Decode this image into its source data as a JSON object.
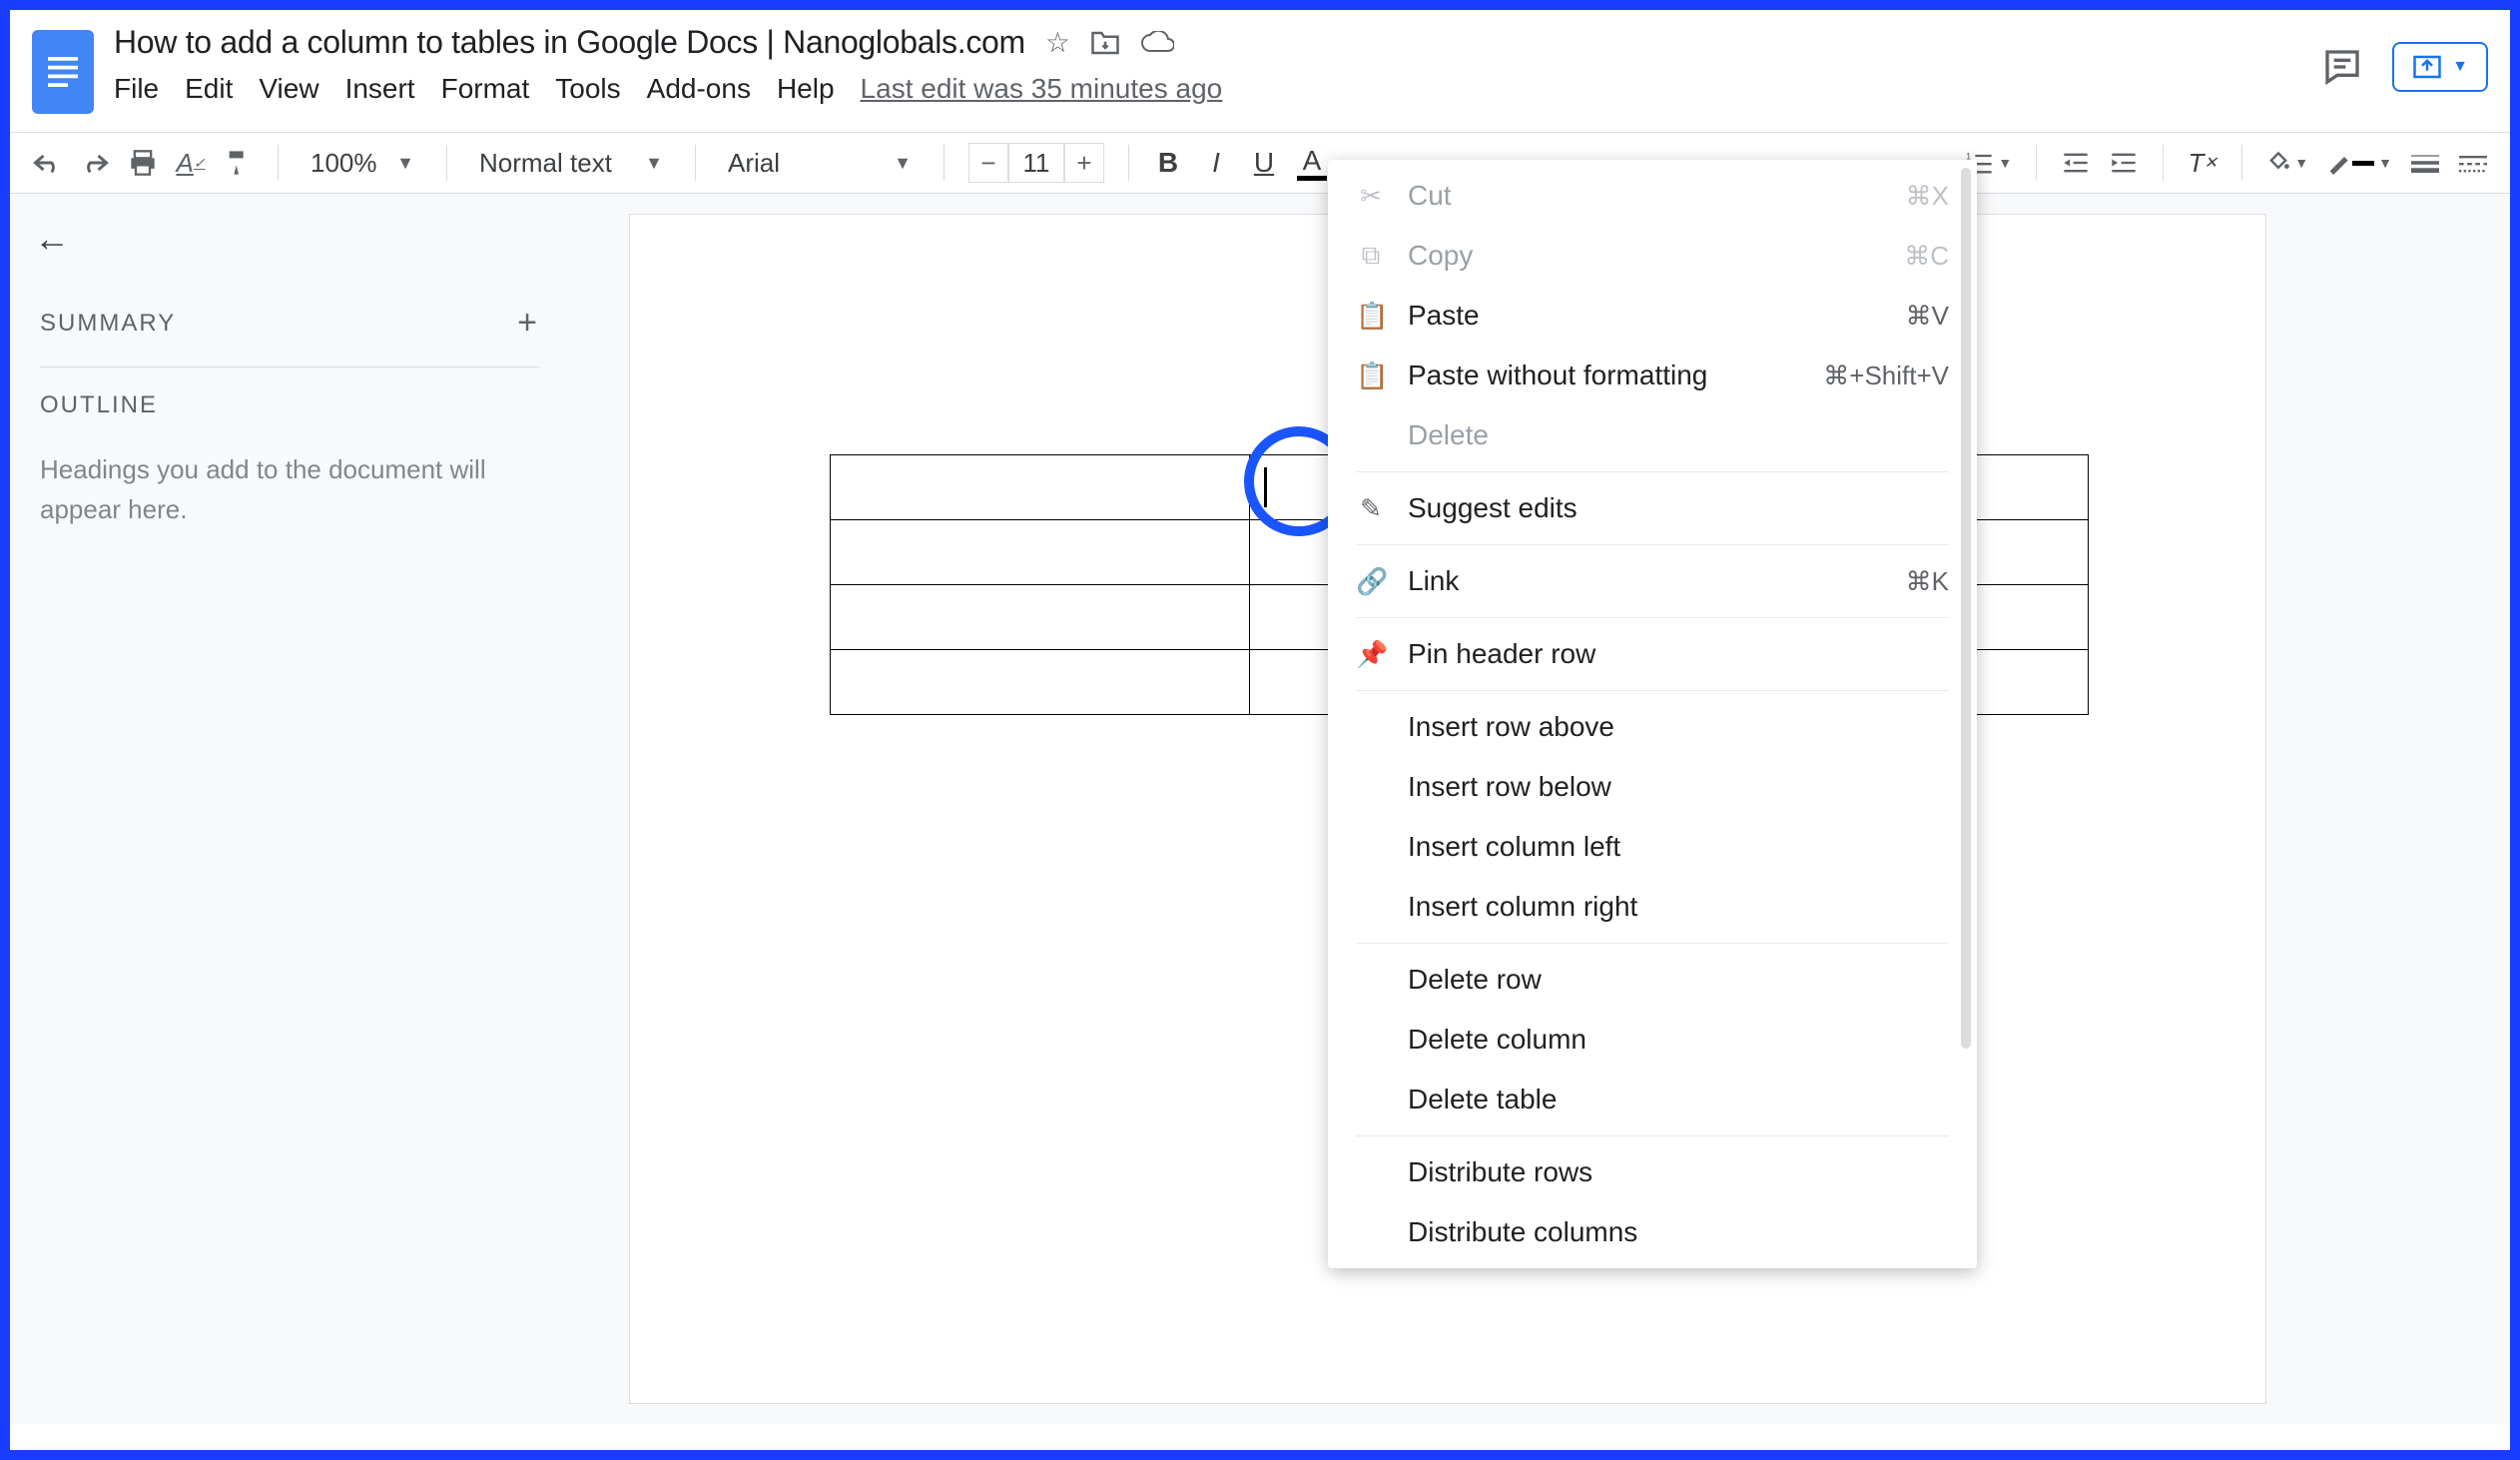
{
  "header": {
    "doc_title": "How to add a column to tables in Google Docs | Nanoglobals.com",
    "last_edit": "Last edit was 35 minutes ago",
    "menus": [
      "File",
      "Edit",
      "View",
      "Insert",
      "Format",
      "Tools",
      "Add-ons",
      "Help"
    ]
  },
  "toolbar": {
    "zoom": "100%",
    "style": "Normal text",
    "font": "Arial",
    "font_size": "11"
  },
  "sidebar": {
    "summary_label": "SUMMARY",
    "outline_label": "OUTLINE",
    "outline_hint": "Headings you add to the document will appear here."
  },
  "context_menu": {
    "items": [
      {
        "icon": "cut",
        "label": "Cut",
        "shortcut": "⌘X",
        "disabled": true
      },
      {
        "icon": "copy",
        "label": "Copy",
        "shortcut": "⌘C",
        "disabled": true
      },
      {
        "icon": "paste",
        "label": "Paste",
        "shortcut": "⌘V",
        "disabled": false
      },
      {
        "icon": "paste-plain",
        "label": "Paste without formatting",
        "shortcut": "⌘+Shift+V",
        "disabled": false
      },
      {
        "icon": "",
        "label": "Delete",
        "shortcut": "",
        "disabled": true
      },
      {
        "sep": true
      },
      {
        "icon": "suggest",
        "label": "Suggest edits",
        "shortcut": "",
        "disabled": false
      },
      {
        "sep": true
      },
      {
        "icon": "link",
        "label": "Link",
        "shortcut": "⌘K",
        "disabled": false
      },
      {
        "sep": true
      },
      {
        "icon": "pin",
        "label": "Pin header row",
        "shortcut": "",
        "disabled": false
      },
      {
        "sep": true
      },
      {
        "icon": "",
        "label": "Insert row above",
        "shortcut": "",
        "disabled": false
      },
      {
        "icon": "",
        "label": "Insert row below",
        "shortcut": "",
        "disabled": false
      },
      {
        "icon": "",
        "label": "Insert column left",
        "shortcut": "",
        "disabled": false
      },
      {
        "icon": "",
        "label": "Insert column right",
        "shortcut": "",
        "disabled": false
      },
      {
        "sep": true
      },
      {
        "icon": "",
        "label": "Delete row",
        "shortcut": "",
        "disabled": false
      },
      {
        "icon": "",
        "label": "Delete column",
        "shortcut": "",
        "disabled": false
      },
      {
        "icon": "",
        "label": "Delete table",
        "shortcut": "",
        "disabled": false
      },
      {
        "sep": true
      },
      {
        "icon": "",
        "label": "Distribute rows",
        "shortcut": "",
        "disabled": false
      },
      {
        "icon": "",
        "label": "Distribute columns",
        "shortcut": "",
        "disabled": false
      }
    ]
  },
  "table": {
    "rows": 4,
    "cols": 3,
    "cursor_cell": [
      0,
      1
    ]
  }
}
